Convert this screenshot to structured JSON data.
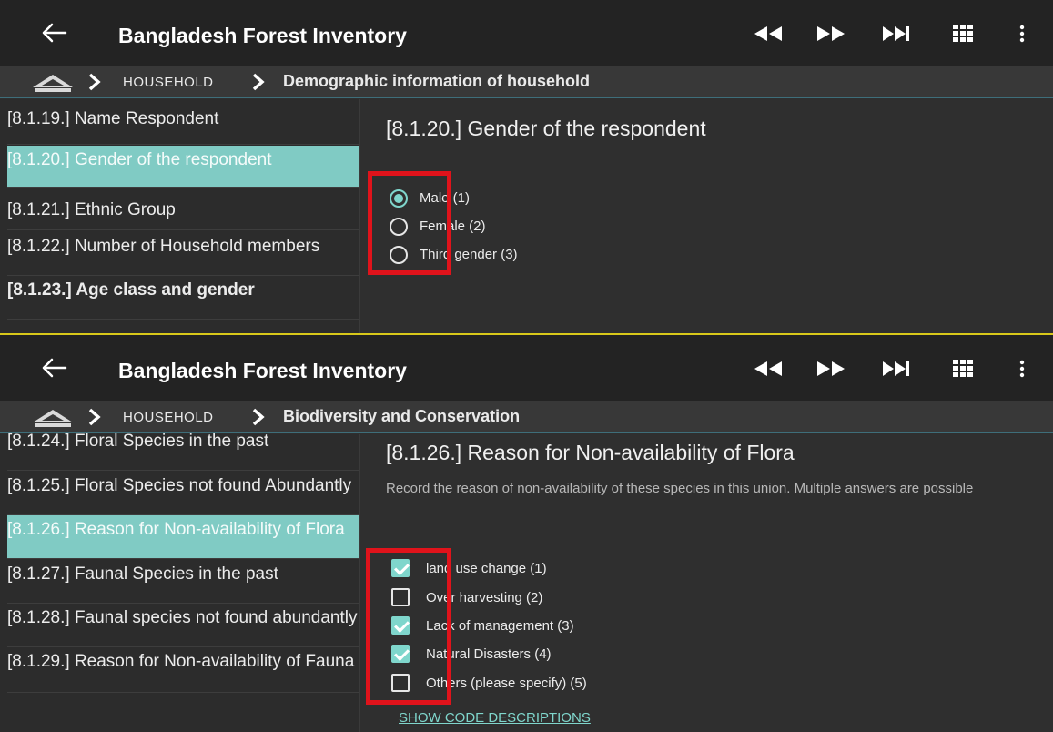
{
  "colors": {
    "accent": "#80cbc4",
    "highlight": "#e0131b",
    "divider": "#d8c81a"
  },
  "icons": {
    "back": "arrow-left-icon",
    "rewind": "rewind-icon",
    "fast_forward": "fast-forward-icon",
    "skip_to_end": "skip-to-end-icon",
    "grid": "grid-icon",
    "more": "more-vert-icon",
    "home": "home-icon",
    "separator": "chevron-right-icon"
  },
  "top": {
    "app_title": "Bangladesh Forest Inventory",
    "breadcrumb": {
      "level1": "HOUSEHOLD",
      "level2": "Demographic information of household"
    },
    "nav": [
      {
        "code": "[8.1.19.]",
        "label": "[8.1.19.] Name Respondent",
        "active": false
      },
      {
        "code": "[8.1.20.]",
        "label": "[8.1.20.] Gender of the respondent",
        "active": true
      },
      {
        "code": "[8.1.21.]",
        "label": "[8.1.21.] Ethnic Group",
        "active": false
      },
      {
        "code": "[8.1.22.]",
        "label": "[8.1.22.] Number of Household members",
        "active": false
      },
      {
        "code": "[8.1.23.]",
        "label": "[8.1.23.] Age class  and gender",
        "active": false
      }
    ],
    "question_title": "[8.1.20.] Gender of the respondent",
    "options": [
      {
        "label": "Male (1)",
        "selected": true
      },
      {
        "label": "Female (2)",
        "selected": false
      },
      {
        "label": "Third gender (3)",
        "selected": false
      }
    ]
  },
  "bottom": {
    "app_title": "Bangladesh Forest Inventory",
    "breadcrumb": {
      "level1": "HOUSEHOLD",
      "level2": "Biodiversity and Conservation"
    },
    "nav": [
      {
        "label": "[8.1.24.] Floral Species in the past",
        "active": false
      },
      {
        "label": "[8.1.25.] Floral Species not found Abundantly",
        "active": false
      },
      {
        "label": "[8.1.26.] Reason for Non-availability of Flora",
        "active": true
      },
      {
        "label": "[8.1.27.] Faunal Species in the past",
        "active": false
      },
      {
        "label": "[8.1.28.] Faunal species not found abundantly",
        "active": false
      },
      {
        "label": "[8.1.29.] Reason for Non-availability of Fauna",
        "active": false
      }
    ],
    "question_title": "[8.1.26.] Reason for Non-availability of Flora",
    "description": "Record the reason of non-availability of these species in this union. Multiple answers are possible",
    "options": [
      {
        "label": "land use change (1)",
        "checked": true
      },
      {
        "label": "Over harvesting (2)",
        "checked": false
      },
      {
        "label": "Lack of management (3)",
        "checked": true
      },
      {
        "label": "Natural Disasters (4)",
        "checked": true
      },
      {
        "label": "Others (please specify) (5)",
        "checked": false
      }
    ],
    "show_codes_link": "SHOW CODE DESCRIPTIONS"
  }
}
